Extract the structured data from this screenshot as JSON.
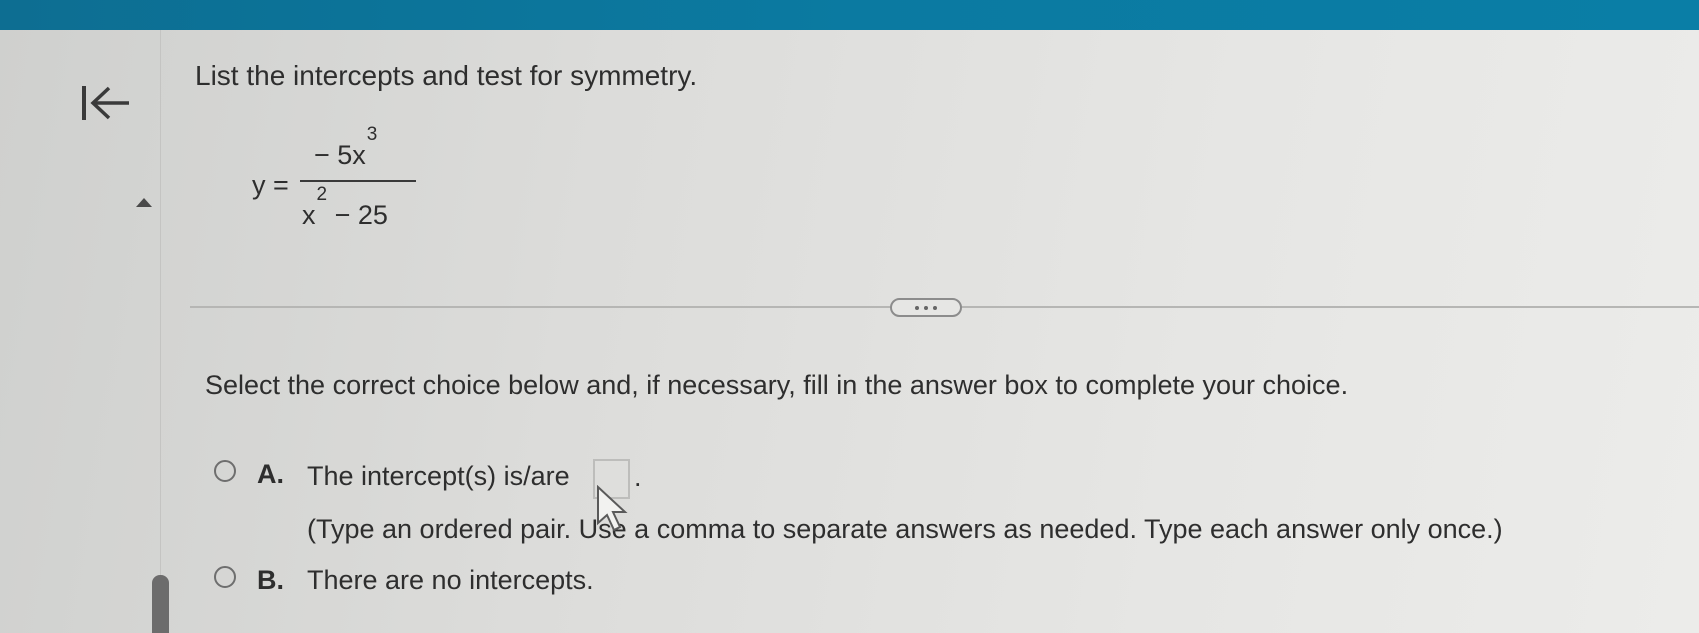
{
  "question": {
    "title": "List the intercepts and test for symmetry.",
    "equation": {
      "lhs": "y =",
      "numerator": "− 5x",
      "numerator_exp": "3",
      "denominator_base": "x",
      "denominator_exp": "2",
      "denominator_rest": "− 25"
    }
  },
  "instruction": "Select the correct choice below and, if necessary, fill in the answer box to complete your choice.",
  "choices": [
    {
      "letter": "A.",
      "text_before": "The intercept(s) is/are",
      "text_after": ".",
      "hint": "(Type an ordered pair. Use a comma to separate answers as needed. Type each answer only once.)",
      "answer_value": ""
    },
    {
      "letter": "B.",
      "text": "There are no intercepts."
    }
  ],
  "colors": {
    "topbar": "#0b7aa1",
    "background": "#e2e2e0",
    "text": "#2e2e2e"
  }
}
